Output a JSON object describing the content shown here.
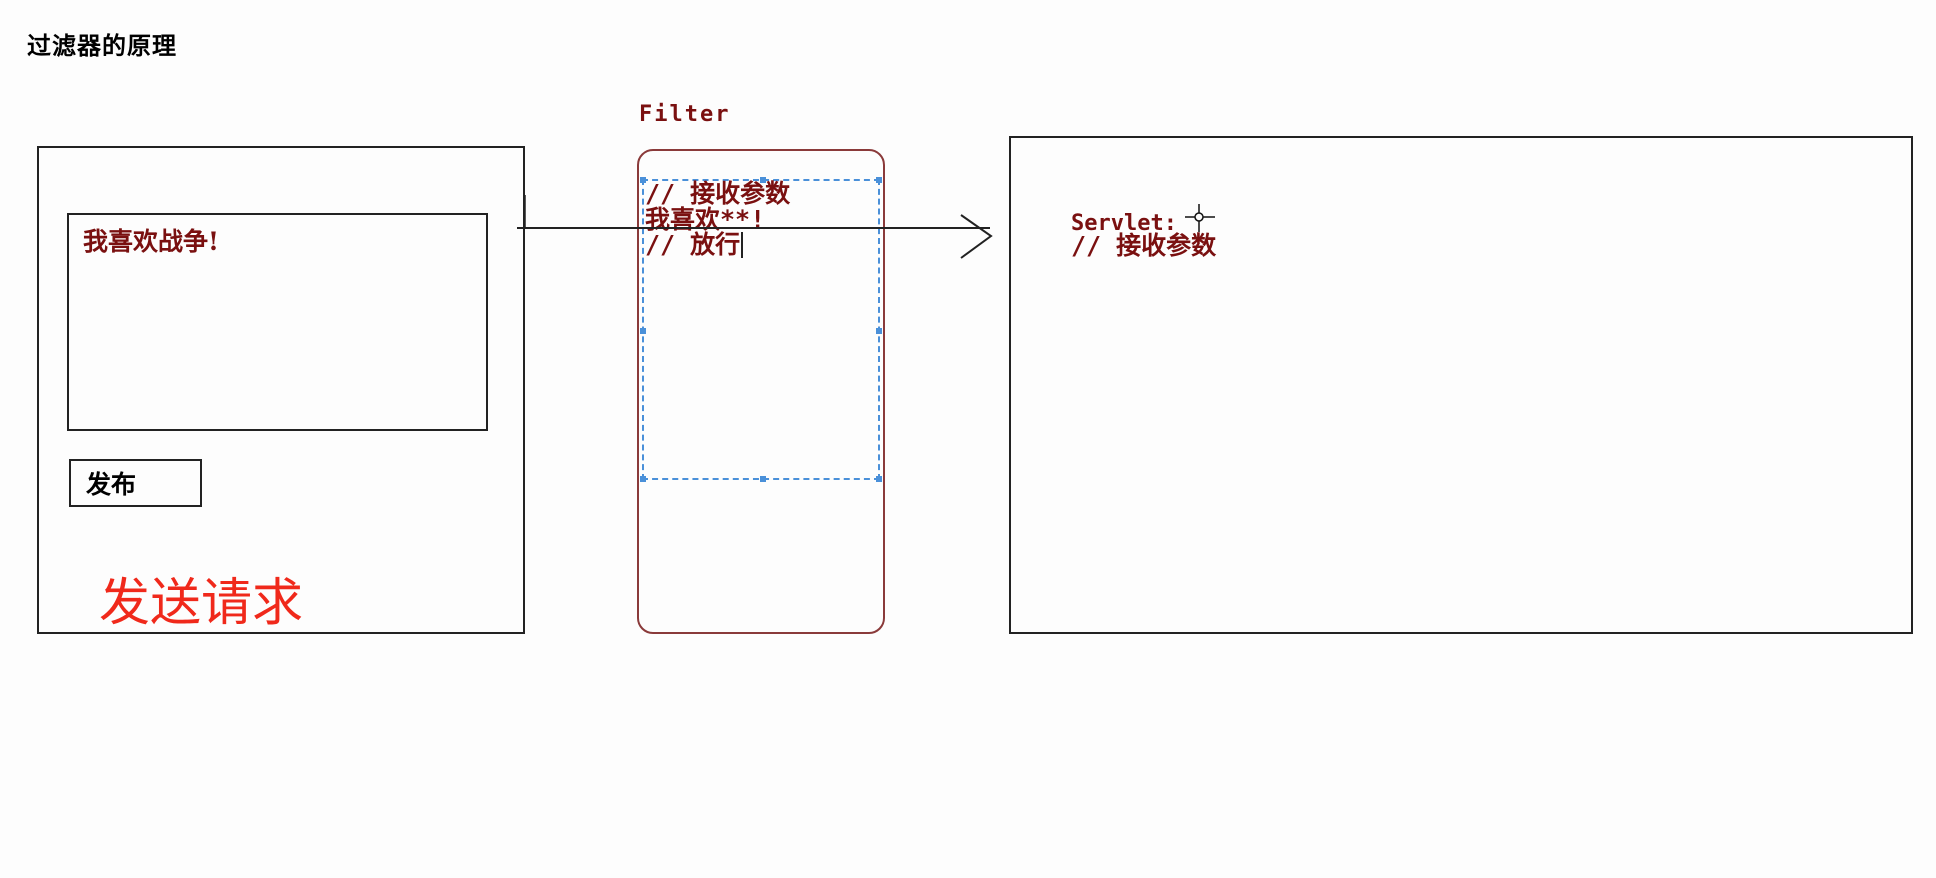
{
  "page": {
    "title": "过滤器的原理"
  },
  "client": {
    "message_text": "我喜欢战争!",
    "publish_label": "发布",
    "send_request_label": "发送请求"
  },
  "filter": {
    "title": "Filter",
    "code_lines": [
      "// 接收参数",
      "我喜欢**!",
      "// 放行"
    ]
  },
  "servlet": {
    "code_lines": [
      "Servlet:",
      "// 接收参数"
    ]
  },
  "icons": {
    "arrow": "arrow-right-icon",
    "cursor": "crosshair-cursor-icon"
  },
  "colors": {
    "code_text": "#7a1010",
    "send_request": "#f0291b",
    "selection": "#4a90d9",
    "filter_border": "#8a3a3a"
  }
}
